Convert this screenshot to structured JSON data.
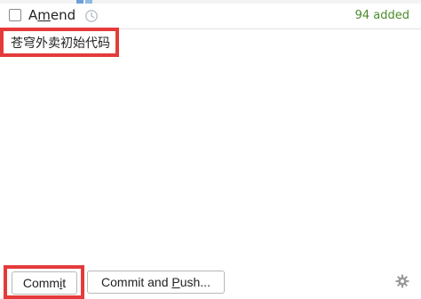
{
  "header": {
    "amend_prefix": "A",
    "amend_mnemonic": "m",
    "amend_suffix": "end",
    "added_status": "94 added"
  },
  "commit_message": "苍穹外卖初始代码",
  "buttons": {
    "commit_prefix": "Comm",
    "commit_mnemonic": "i",
    "commit_suffix": "t",
    "commit_push_prefix": "Commit and ",
    "commit_push_mnemonic": "P",
    "commit_push_suffix": "ush..."
  },
  "icons": {
    "history": "clock-history-icon",
    "settings": "gear-icon"
  },
  "colors": {
    "added_status": "#4b8b2b",
    "highlight_box": "#e53a3a"
  }
}
